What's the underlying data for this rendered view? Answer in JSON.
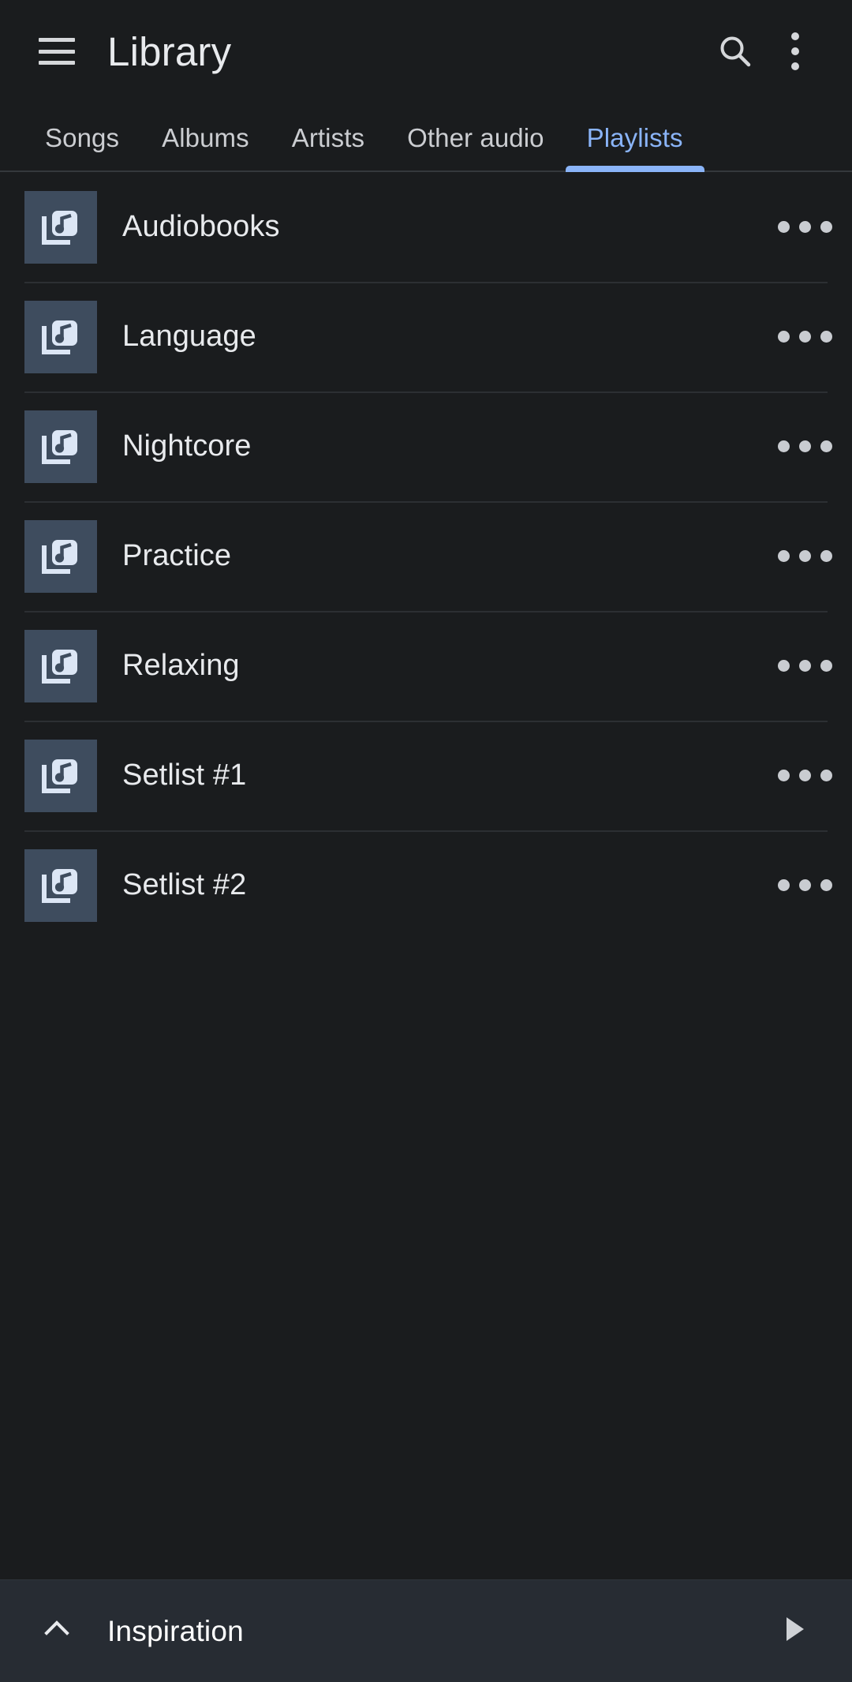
{
  "theme": {
    "background": "#1a1c1e",
    "surface": "#272c33",
    "accent": "#8ab4f8",
    "text_primary": "#e8eaed",
    "text_secondary": "#cbcdd1",
    "thumb_background": "#3e4c5e",
    "thumb_icon": "#dce6f5",
    "divider": "#2c2f33"
  },
  "appbar": {
    "menu_icon": "hamburger-menu-icon",
    "title": "Library",
    "search_icon": "search-icon",
    "overflow_icon": "more-vertical-icon"
  },
  "tabs": {
    "active_index": 4,
    "items": [
      {
        "label": "Songs"
      },
      {
        "label": "Albums"
      },
      {
        "label": "Artists"
      },
      {
        "label": "Other audio"
      },
      {
        "label": "Playlists"
      }
    ]
  },
  "playlists": {
    "row_icon": "playlist-music-icon",
    "row_menu_icon": "more-horizontal-icon",
    "items": [
      {
        "name": "Audiobooks"
      },
      {
        "name": "Language"
      },
      {
        "name": "Nightcore"
      },
      {
        "name": "Practice"
      },
      {
        "name": "Relaxing"
      },
      {
        "name": "Setlist #1"
      },
      {
        "name": "Setlist #2"
      }
    ]
  },
  "now_playing": {
    "expand_icon": "chevron-up-icon",
    "title": "Inspiration",
    "play_icon": "play-icon"
  }
}
